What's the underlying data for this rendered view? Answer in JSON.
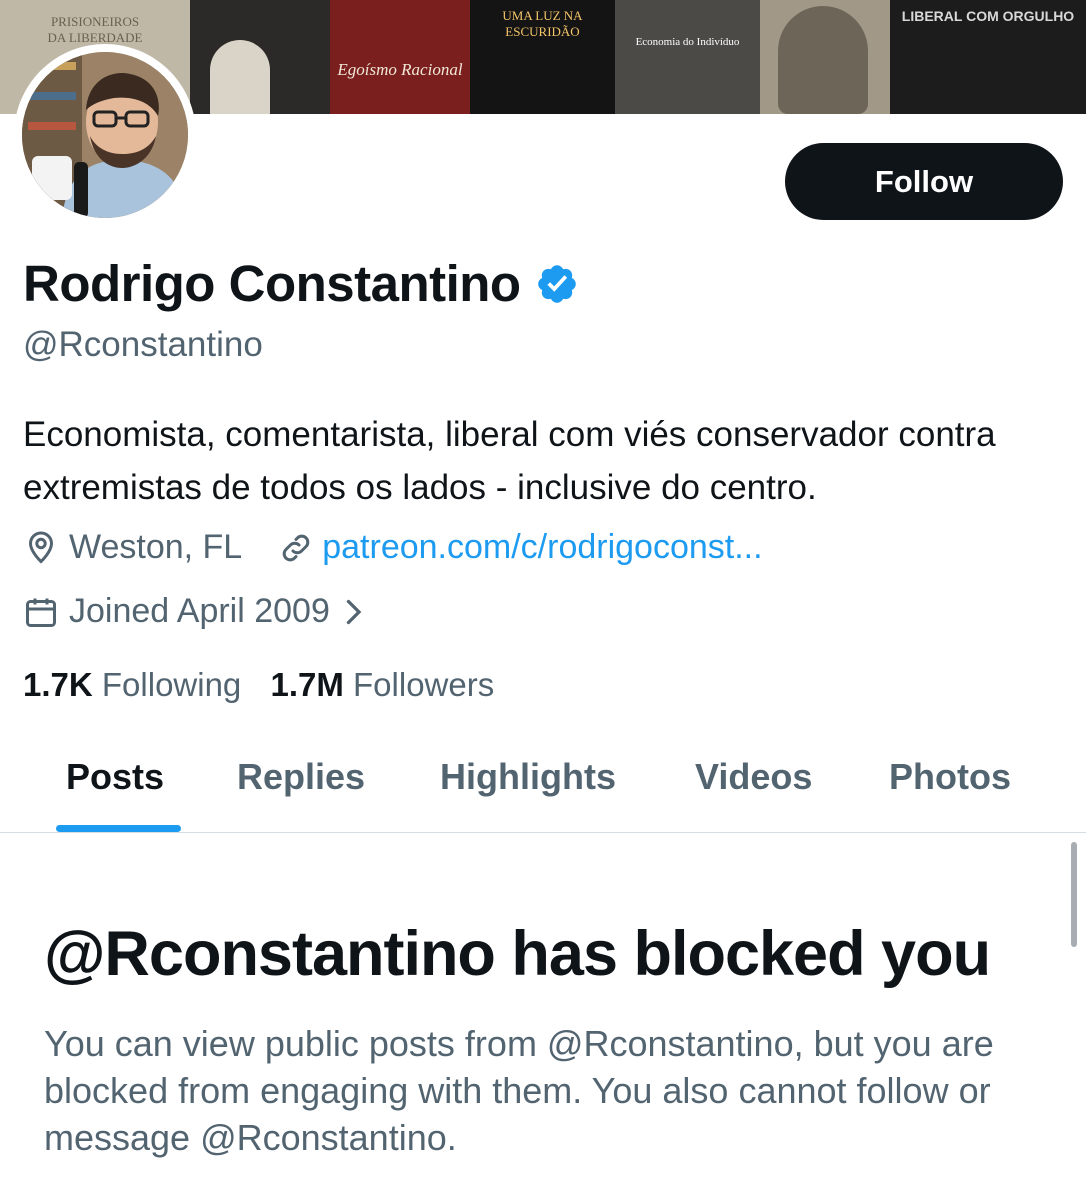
{
  "banner": {
    "book_titles": [
      "PRISIONEIROS DA LIBERDADE",
      "UMA LUZ NA ESCURIDÃO",
      "Egoísmo Racional",
      "Economia do Indivíduo",
      "LIBERAL COM ORGULHO"
    ]
  },
  "profile": {
    "display_name": "Rodrigo Constantino",
    "handle": "@Rconstantino",
    "bio": "Economista, comentarista, liberal com viés conservador contra extremistas de todos os lados - inclusive do centro.",
    "location": "Weston, FL",
    "website": "patreon.com/c/rodrigoconst...",
    "joined": "Joined April 2009",
    "verified_icon": "verified-badge-icon"
  },
  "actions": {
    "follow_label": "Follow"
  },
  "stats": {
    "following_count": "1.7K",
    "following_label": "Following",
    "followers_count": "1.7M",
    "followers_label": "Followers"
  },
  "tabs": [
    {
      "label": "Posts",
      "active": true
    },
    {
      "label": "Replies",
      "active": false
    },
    {
      "label": "Highlights",
      "active": false
    },
    {
      "label": "Videos",
      "active": false
    },
    {
      "label": "Photos",
      "active": false
    }
  ],
  "blocked": {
    "title": "@Rconstantino has blocked you",
    "message": "You can view public posts from @Rconstantino, but you are blocked from engaging with them. You also cannot follow or message @Rconstantino."
  },
  "colors": {
    "accent": "#1d9bf0",
    "text_primary": "#0f1419",
    "text_secondary": "#536471",
    "button_bg": "#0f1419"
  }
}
